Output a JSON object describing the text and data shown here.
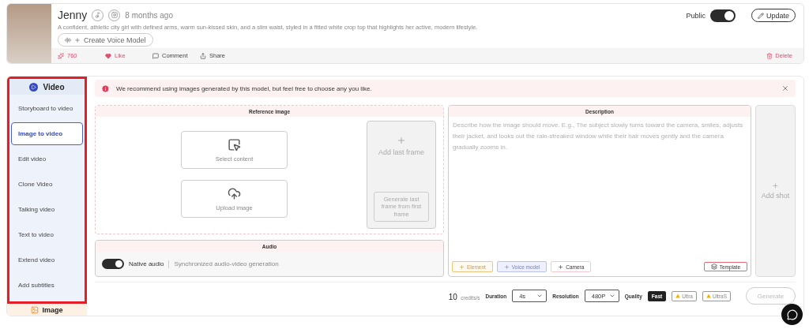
{
  "profile": {
    "name": "Jenny",
    "time": "8 months ago",
    "description": "A confident, athletic city girl with defined arms, warm sun-kissed skin, and a slim waist, styled in a fitted white crop top that highlights her active, modern lifestyle.",
    "voice_button": "Create Voice Model",
    "visibility_label": "Public",
    "public": true,
    "update": "Update",
    "actions": [
      {
        "kind": "sparks",
        "label": "760"
      },
      {
        "kind": "like",
        "label": "Like"
      },
      {
        "kind": "comment",
        "label": "Comment"
      },
      {
        "kind": "share",
        "label": "Share"
      }
    ],
    "delete": "Delete"
  },
  "sidebar": {
    "header": "Video",
    "items": [
      {
        "label": "Storyboard to video",
        "selected": false
      },
      {
        "label": "Image to video",
        "selected": true
      },
      {
        "label": "Edit video",
        "selected": false
      },
      {
        "label": "Clone Video",
        "selected": false
      },
      {
        "label": "Talking video",
        "selected": false
      },
      {
        "label": "Text to video",
        "selected": false
      },
      {
        "label": "Extend video",
        "selected": false
      },
      {
        "label": "Add subtitles",
        "selected": false
      }
    ],
    "next_section": "Image"
  },
  "alert": "We recommend using images generated by this model, but feel free to choose any you like.",
  "reference": {
    "title": "Reference image",
    "select": "Select content",
    "upload": "Upload image",
    "add_last_frame": "Add last frame",
    "generate_last": "Generate last frame from first frame"
  },
  "audio": {
    "title": "Audio",
    "on": true,
    "label": "Native audio",
    "hint": "Synchronized audio-video generation"
  },
  "description": {
    "title": "Description",
    "placeholder": "Describe how the image should move. E.g., The subject slowly turns toward the camera, smiles, adjusts their jacket, and looks out the rain-streaked window while their hair moves gently and the camera gradually zooms in.",
    "chips": [
      {
        "kind": "element",
        "label": "Element"
      },
      {
        "kind": "voice",
        "label": "Voice model"
      },
      {
        "kind": "camera",
        "label": "Camera"
      }
    ],
    "template": "Template"
  },
  "add_shot": "Add shot",
  "footer": {
    "credits": "10",
    "credits_unit": "credits/s",
    "duration_label": "Duration",
    "duration": "4s",
    "resolution_label": "Resolution",
    "resolution": "480P",
    "quality_label": "Quality",
    "quality": [
      {
        "label": "Fast",
        "selected": true,
        "premium": false
      },
      {
        "label": "Ultra",
        "selected": false,
        "premium": true
      },
      {
        "label": "UltraS",
        "selected": false,
        "premium": true
      }
    ],
    "generate": "Generate",
    "generate_disabled": true
  }
}
